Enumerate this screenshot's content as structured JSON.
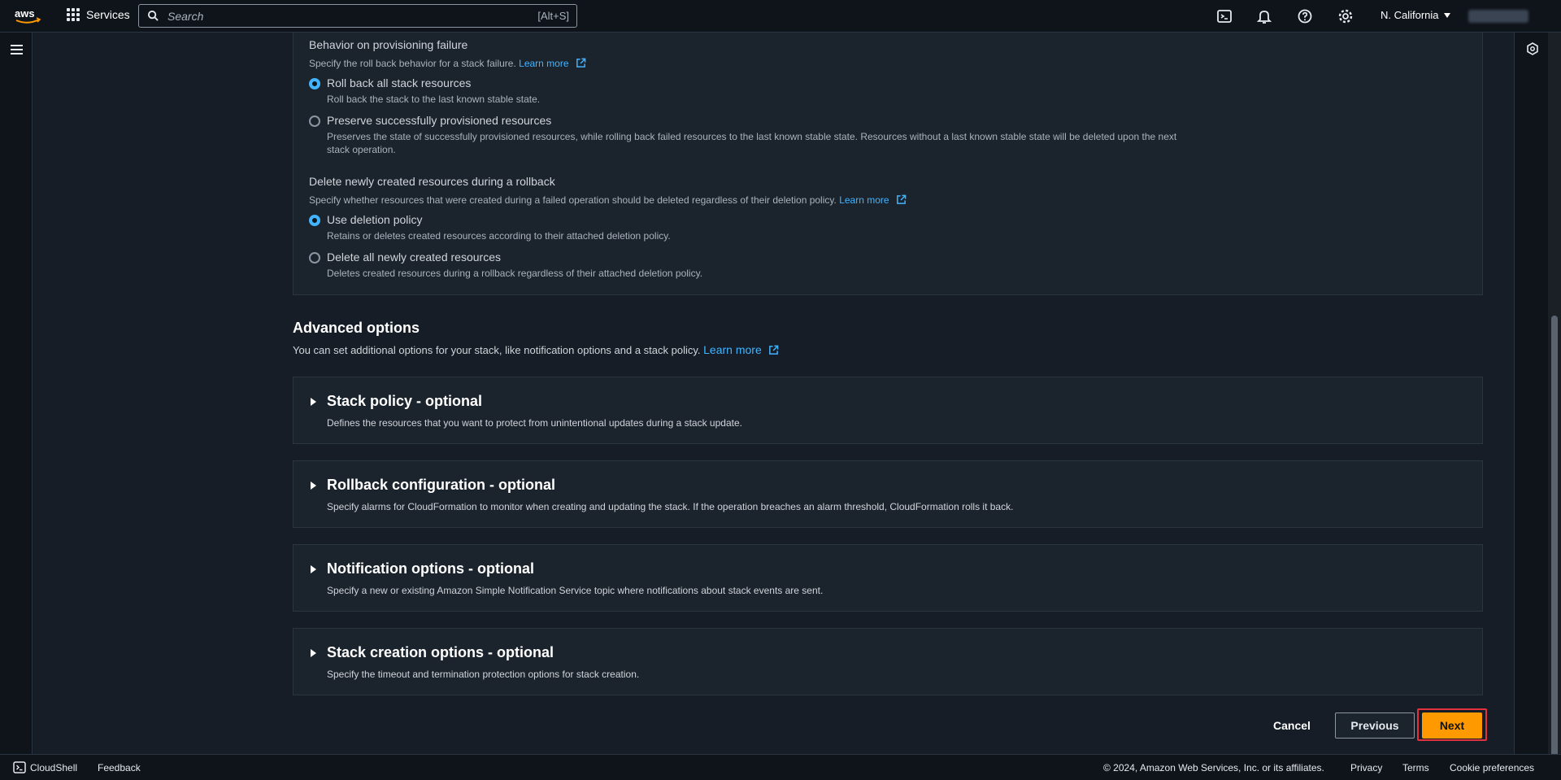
{
  "topnav": {
    "services_label": "Services",
    "search_placeholder": "Search",
    "search_shortcut": "[Alt+S]",
    "region_label": "N. California"
  },
  "rollback_failure": {
    "heading": "Behavior on provisioning failure",
    "description": "Specify the roll back behavior for a stack failure.",
    "learn_more": "Learn more",
    "options": [
      {
        "label": "Roll back all stack resources",
        "desc": "Roll back the stack to the last known stable state.",
        "checked": true
      },
      {
        "label": "Preserve successfully provisioned resources",
        "desc": "Preserves the state of successfully provisioned resources, while rolling back failed resources to the last known stable state. Resources without a last known stable state will be deleted upon the next stack operation.",
        "checked": false
      }
    ]
  },
  "delete_new": {
    "heading": "Delete newly created resources during a rollback",
    "description": "Specify whether resources that were created during a failed operation should be deleted regardless of their deletion policy.",
    "learn_more": "Learn more",
    "options": [
      {
        "label": "Use deletion policy",
        "desc": "Retains or deletes created resources according to their attached deletion policy.",
        "checked": true
      },
      {
        "label": "Delete all newly created resources",
        "desc": "Deletes created resources during a rollback regardless of their attached deletion policy.",
        "checked": false
      }
    ]
  },
  "advanced": {
    "title": "Advanced options",
    "description": "You can set additional options for your stack, like notification options and a stack policy.",
    "learn_more": "Learn more",
    "sections": [
      {
        "title": "Stack policy - optional",
        "desc": "Defines the resources that you want to protect from unintentional updates during a stack update."
      },
      {
        "title": "Rollback configuration - optional",
        "desc": "Specify alarms for CloudFormation to monitor when creating and updating the stack. If the operation breaches an alarm threshold, CloudFormation rolls it back."
      },
      {
        "title": "Notification options - optional",
        "desc": "Specify a new or existing Amazon Simple Notification Service topic where notifications about stack events are sent."
      },
      {
        "title": "Stack creation options - optional",
        "desc": "Specify the timeout and termination protection options for stack creation."
      }
    ]
  },
  "actions": {
    "cancel": "Cancel",
    "previous": "Previous",
    "next": "Next"
  },
  "footer": {
    "cloudshell": "CloudShell",
    "feedback": "Feedback",
    "copyright": "© 2024, Amazon Web Services, Inc. or its affiliates.",
    "privacy": "Privacy",
    "terms": "Terms",
    "cookie_preferences": "Cookie preferences"
  },
  "colors": {
    "accent_link": "#42b4ff",
    "primary_button": "#ff9900",
    "highlight_border": "#e0323f"
  }
}
